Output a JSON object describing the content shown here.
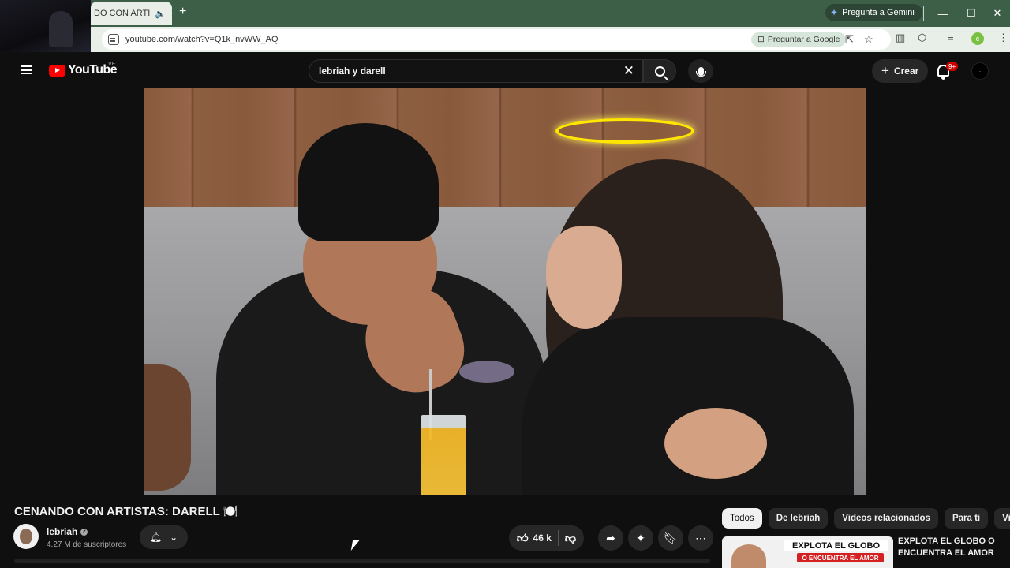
{
  "browser": {
    "tab_title": "DO CON ARTI",
    "new_tab": "+",
    "gemini_label": "Pregunta a Gemini",
    "url": "youtube.com/watch?v=Q1k_nvWW_AQ",
    "ask_google": "Preguntar a Google",
    "profile_initial": "c"
  },
  "youtube": {
    "logo_text": "YouTube",
    "country_code": "VE",
    "search_value": "lebriah y darell",
    "create_label": "Crear",
    "notif_count": "9+"
  },
  "video": {
    "title": "CENANDO CON ARTISTAS: DARELL 🍽️",
    "channel_name": "lebriah",
    "subscribers": "4.27 M de suscriptores",
    "likes": "46 k"
  },
  "chips": [
    "Todos",
    "De lebriah",
    "Videos relacionados",
    "Para ti",
    "Visto"
  ],
  "recommendation": {
    "title": "EXPLOTA EL GLOBO O ENCUENTRA EL AMOR",
    "thumb_text_1": "EXPLOTA EL GLOBO",
    "thumb_text_2": "O ENCUENTRA EL AMOR"
  },
  "colors": {
    "yt_red": "#ff0000",
    "bg": "#0f0f0f",
    "chrome_green": "#3d5e47",
    "halo": "#ffe600"
  }
}
